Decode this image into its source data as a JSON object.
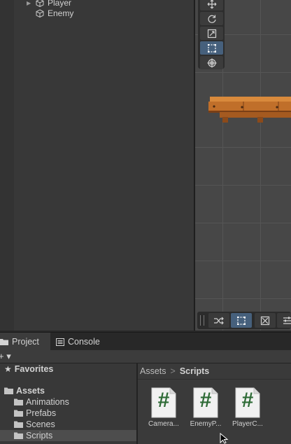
{
  "hierarchy": {
    "items": [
      {
        "label": "Player",
        "expandable": true
      },
      {
        "label": "Enemy",
        "expandable": false
      }
    ]
  },
  "scene": {
    "tools": [
      {
        "name": "move-tool",
        "icon": "move-icon",
        "active": false
      },
      {
        "name": "rotate-tool",
        "icon": "rotate-icon",
        "active": false
      },
      {
        "name": "scale-tool",
        "icon": "scale-icon",
        "active": false
      },
      {
        "name": "rect-tool",
        "icon": "rect-icon",
        "active": true
      },
      {
        "name": "transform-tool",
        "icon": "transform-icon",
        "active": false
      }
    ],
    "snap_buttons": [
      "shuffle-icon",
      "rect-snap-icon",
      "grid-snap-icon",
      "settings-icon"
    ]
  },
  "project": {
    "tabs": [
      {
        "label": "Project",
        "icon": "folder-icon",
        "active": true
      },
      {
        "label": "Console",
        "icon": "console-icon",
        "active": false
      }
    ],
    "toolbar": {
      "add_label": "+ ▾"
    },
    "tree": {
      "favorites": "Favorites",
      "assets": "Assets",
      "children": [
        "Animations",
        "Prefabs",
        "Scenes",
        "Scripts"
      ],
      "selected": "Scripts"
    },
    "breadcrumb": {
      "root": "Assets",
      "separator": ">",
      "current": "Scripts"
    },
    "assets": [
      {
        "label": "Camera...",
        "icon": "#"
      },
      {
        "label": "EnemyP...",
        "icon": "#"
      },
      {
        "label": "PlayerC...",
        "icon": "#"
      }
    ],
    "script_color": "#2e6b36"
  }
}
